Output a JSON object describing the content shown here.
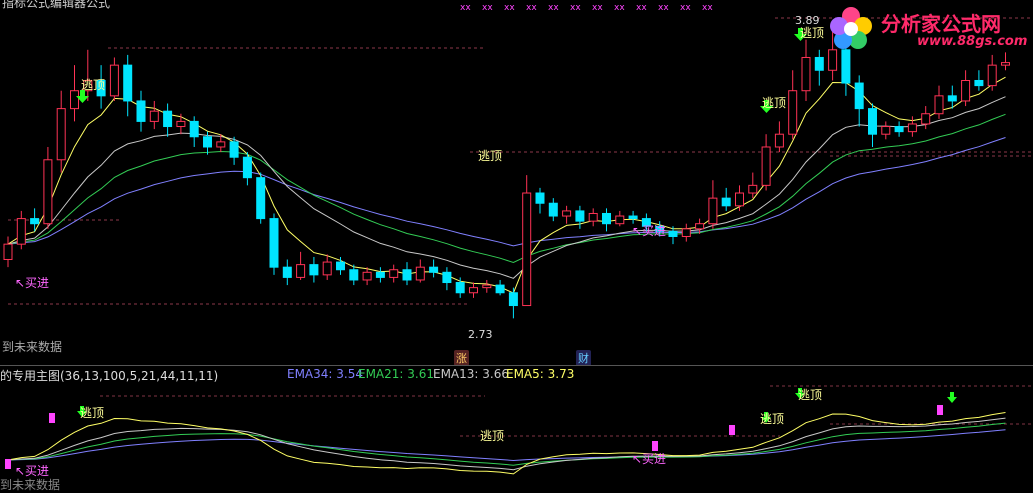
{
  "colors": {
    "up": "#ff3355",
    "down": "#00e5ff",
    "ema34": "#8080ff",
    "ema21": "#33cc55",
    "ema13": "#c8c8c8",
    "ema5": "#ffff66",
    "guide": "#ff6688",
    "marker": "#ff44ff",
    "arrow": "#22ff22",
    "label_pink": "#ff66ff",
    "label_yellow": "#ffff99"
  },
  "header_text": "指标公式编辑器公式",
  "logo": {
    "title": "分析家公式网",
    "url": "www.88gs.com"
  },
  "main": {
    "price_high": "3.89",
    "price_low": "2.73",
    "future_label": "到未来数据",
    "signals": [
      {
        "kind": "sell",
        "text": "逃顶"
      },
      {
        "kind": "sell",
        "text": "逃顶"
      },
      {
        "kind": "sell",
        "text": "逃顶"
      },
      {
        "kind": "sell",
        "text": "逃顶"
      },
      {
        "kind": "buy",
        "text": "↖买进"
      },
      {
        "kind": "buy",
        "text": "↖买进"
      }
    ],
    "badges": [
      {
        "text": "涨"
      },
      {
        "text": "财"
      }
    ]
  },
  "sub": {
    "title": "的专用主图(36,13,100,5,21,44,11,11)",
    "ema34_label": "EMA34:",
    "ema34_value": "3.54",
    "ema21_label": "EMA21:",
    "ema21_value": "3.61",
    "ema13_label": "EMA13:",
    "ema13_value": "3.66",
    "ema5_label": "EMA5:",
    "ema5_value": "3.73",
    "future_label": "到未来数据",
    "signals": [
      {
        "kind": "sell",
        "text": "逃顶"
      },
      {
        "kind": "sell",
        "text": "逃顶"
      },
      {
        "kind": "sell",
        "text": "逃顶"
      },
      {
        "kind": "sell",
        "text": "逃顶"
      },
      {
        "kind": "buy",
        "text": "↖买进"
      },
      {
        "kind": "buy",
        "text": "↖买进"
      }
    ]
  },
  "chart_data": {
    "type": "candlestick",
    "price_range": [
      2.73,
      3.89
    ],
    "candles": [
      {
        "o": 2.96,
        "c": 3.02,
        "h": 3.05,
        "l": 2.93
      },
      {
        "o": 3.02,
        "c": 3.12,
        "h": 3.15,
        "l": 3.0
      },
      {
        "o": 3.12,
        "c": 3.1,
        "h": 3.16,
        "l": 3.07
      },
      {
        "o": 3.1,
        "c": 3.35,
        "h": 3.4,
        "l": 3.08
      },
      {
        "o": 3.35,
        "c": 3.55,
        "h": 3.62,
        "l": 3.3
      },
      {
        "o": 3.55,
        "c": 3.62,
        "h": 3.72,
        "l": 3.5
      },
      {
        "o": 3.62,
        "c": 3.66,
        "h": 3.78,
        "l": 3.58
      },
      {
        "o": 3.66,
        "c": 3.6,
        "h": 3.72,
        "l": 3.55
      },
      {
        "o": 3.6,
        "c": 3.72,
        "h": 3.75,
        "l": 3.58
      },
      {
        "o": 3.72,
        "c": 3.58,
        "h": 3.76,
        "l": 3.52
      },
      {
        "o": 3.58,
        "c": 3.5,
        "h": 3.62,
        "l": 3.46
      },
      {
        "o": 3.5,
        "c": 3.54,
        "h": 3.58,
        "l": 3.47
      },
      {
        "o": 3.54,
        "c": 3.48,
        "h": 3.57,
        "l": 3.44
      },
      {
        "o": 3.48,
        "c": 3.5,
        "h": 3.53,
        "l": 3.45
      },
      {
        "o": 3.5,
        "c": 3.44,
        "h": 3.52,
        "l": 3.4
      },
      {
        "o": 3.44,
        "c": 3.4,
        "h": 3.46,
        "l": 3.37
      },
      {
        "o": 3.4,
        "c": 3.42,
        "h": 3.45,
        "l": 3.38
      },
      {
        "o": 3.42,
        "c": 3.36,
        "h": 3.44,
        "l": 3.33
      },
      {
        "o": 3.36,
        "c": 3.28,
        "h": 3.38,
        "l": 3.25
      },
      {
        "o": 3.28,
        "c": 3.12,
        "h": 3.3,
        "l": 3.1
      },
      {
        "o": 3.12,
        "c": 2.93,
        "h": 3.14,
        "l": 2.9
      },
      {
        "o": 2.93,
        "c": 2.89,
        "h": 2.96,
        "l": 2.86
      },
      {
        "o": 2.89,
        "c": 2.94,
        "h": 2.99,
        "l": 2.88
      },
      {
        "o": 2.94,
        "c": 2.9,
        "h": 2.97,
        "l": 2.87
      },
      {
        "o": 2.9,
        "c": 2.95,
        "h": 2.98,
        "l": 2.88
      },
      {
        "o": 2.95,
        "c": 2.92,
        "h": 2.97,
        "l": 2.9
      },
      {
        "o": 2.92,
        "c": 2.88,
        "h": 2.94,
        "l": 2.86
      },
      {
        "o": 2.88,
        "c": 2.91,
        "h": 2.93,
        "l": 2.86
      },
      {
        "o": 2.91,
        "c": 2.89,
        "h": 2.93,
        "l": 2.87
      },
      {
        "o": 2.89,
        "c": 2.92,
        "h": 2.94,
        "l": 2.87
      },
      {
        "o": 2.92,
        "c": 2.88,
        "h": 2.95,
        "l": 2.86
      },
      {
        "o": 2.88,
        "c": 2.93,
        "h": 2.96,
        "l": 2.87
      },
      {
        "o": 2.93,
        "c": 2.91,
        "h": 2.96,
        "l": 2.89
      },
      {
        "o": 2.91,
        "c": 2.87,
        "h": 2.93,
        "l": 2.84
      },
      {
        "o": 2.87,
        "c": 2.83,
        "h": 2.89,
        "l": 2.81
      },
      {
        "o": 2.83,
        "c": 2.85,
        "h": 2.87,
        "l": 2.81
      },
      {
        "o": 2.85,
        "c": 2.86,
        "h": 2.88,
        "l": 2.83
      },
      {
        "o": 2.86,
        "c": 2.83,
        "h": 2.88,
        "l": 2.82
      },
      {
        "o": 2.83,
        "c": 2.78,
        "h": 2.85,
        "l": 2.73
      },
      {
        "o": 2.78,
        "c": 3.22,
        "h": 3.29,
        "l": 2.78
      },
      {
        "o": 3.22,
        "c": 3.18,
        "h": 3.24,
        "l": 3.14
      },
      {
        "o": 3.18,
        "c": 3.13,
        "h": 3.2,
        "l": 3.11
      },
      {
        "o": 3.13,
        "c": 3.15,
        "h": 3.17,
        "l": 3.1
      },
      {
        "o": 3.15,
        "c": 3.11,
        "h": 3.17,
        "l": 3.08
      },
      {
        "o": 3.11,
        "c": 3.14,
        "h": 3.16,
        "l": 3.09
      },
      {
        "o": 3.14,
        "c": 3.1,
        "h": 3.16,
        "l": 3.07
      },
      {
        "o": 3.1,
        "c": 3.13,
        "h": 3.15,
        "l": 3.09
      },
      {
        "o": 3.13,
        "c": 3.12,
        "h": 3.15,
        "l": 3.1
      },
      {
        "o": 3.12,
        "c": 3.09,
        "h": 3.14,
        "l": 3.07
      },
      {
        "o": 3.09,
        "c": 3.07,
        "h": 3.11,
        "l": 3.05
      },
      {
        "o": 3.07,
        "c": 3.05,
        "h": 3.09,
        "l": 3.02
      },
      {
        "o": 3.05,
        "c": 3.08,
        "h": 3.1,
        "l": 3.03
      },
      {
        "o": 3.08,
        "c": 3.1,
        "h": 3.12,
        "l": 3.06
      },
      {
        "o": 3.1,
        "c": 3.2,
        "h": 3.27,
        "l": 3.08
      },
      {
        "o": 3.2,
        "c": 3.17,
        "h": 3.24,
        "l": 3.15
      },
      {
        "o": 3.17,
        "c": 3.22,
        "h": 3.25,
        "l": 3.15
      },
      {
        "o": 3.22,
        "c": 3.25,
        "h": 3.3,
        "l": 3.2
      },
      {
        "o": 3.25,
        "c": 3.4,
        "h": 3.45,
        "l": 3.23
      },
      {
        "o": 3.4,
        "c": 3.45,
        "h": 3.5,
        "l": 3.38
      },
      {
        "o": 3.45,
        "c": 3.62,
        "h": 3.7,
        "l": 3.43
      },
      {
        "o": 3.62,
        "c": 3.75,
        "h": 3.82,
        "l": 3.58
      },
      {
        "o": 3.75,
        "c": 3.7,
        "h": 3.78,
        "l": 3.64
      },
      {
        "o": 3.7,
        "c": 3.78,
        "h": 3.89,
        "l": 3.66
      },
      {
        "o": 3.78,
        "c": 3.65,
        "h": 3.8,
        "l": 3.6
      },
      {
        "o": 3.65,
        "c": 3.55,
        "h": 3.68,
        "l": 3.48
      },
      {
        "o": 3.55,
        "c": 3.45,
        "h": 3.57,
        "l": 3.4
      },
      {
        "o": 3.45,
        "c": 3.48,
        "h": 3.5,
        "l": 3.43
      },
      {
        "o": 3.48,
        "c": 3.46,
        "h": 3.5,
        "l": 3.44
      },
      {
        "o": 3.46,
        "c": 3.49,
        "h": 3.52,
        "l": 3.44
      },
      {
        "o": 3.49,
        "c": 3.53,
        "h": 3.56,
        "l": 3.47
      },
      {
        "o": 3.53,
        "c": 3.6,
        "h": 3.64,
        "l": 3.51
      },
      {
        "o": 3.6,
        "c": 3.58,
        "h": 3.64,
        "l": 3.55
      },
      {
        "o": 3.58,
        "c": 3.66,
        "h": 3.7,
        "l": 3.56
      },
      {
        "o": 3.66,
        "c": 3.64,
        "h": 3.7,
        "l": 3.62
      },
      {
        "o": 3.64,
        "c": 3.72,
        "h": 3.76,
        "l": 3.62
      },
      {
        "o": 3.72,
        "c": 3.73,
        "h": 3.77,
        "l": 3.7
      }
    ]
  }
}
